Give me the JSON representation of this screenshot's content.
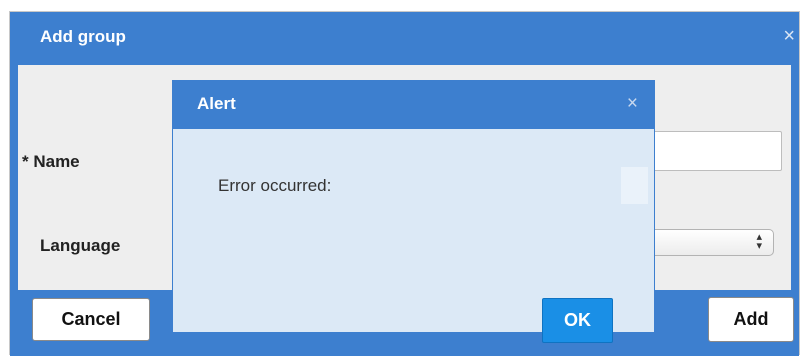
{
  "colors": {
    "header_blue": "#3d7fcf",
    "body_gray": "#eeeeee",
    "alert_body": "#dce9f6",
    "ok_blue": "#1a8fe6"
  },
  "dialog": {
    "title": "Add group",
    "close_icon": "×",
    "fields": {
      "name_label": "* Name",
      "name_value": "",
      "language_label": "Language",
      "language_value": ""
    },
    "buttons": {
      "cancel": "Cancel",
      "add": "Add"
    }
  },
  "alert": {
    "title": "Alert",
    "close_icon": "×",
    "message": "Error occurred:",
    "ok_label": "OK"
  },
  "icons": {
    "close": "close-icon",
    "select_arrow": "select-arrow-icon"
  }
}
